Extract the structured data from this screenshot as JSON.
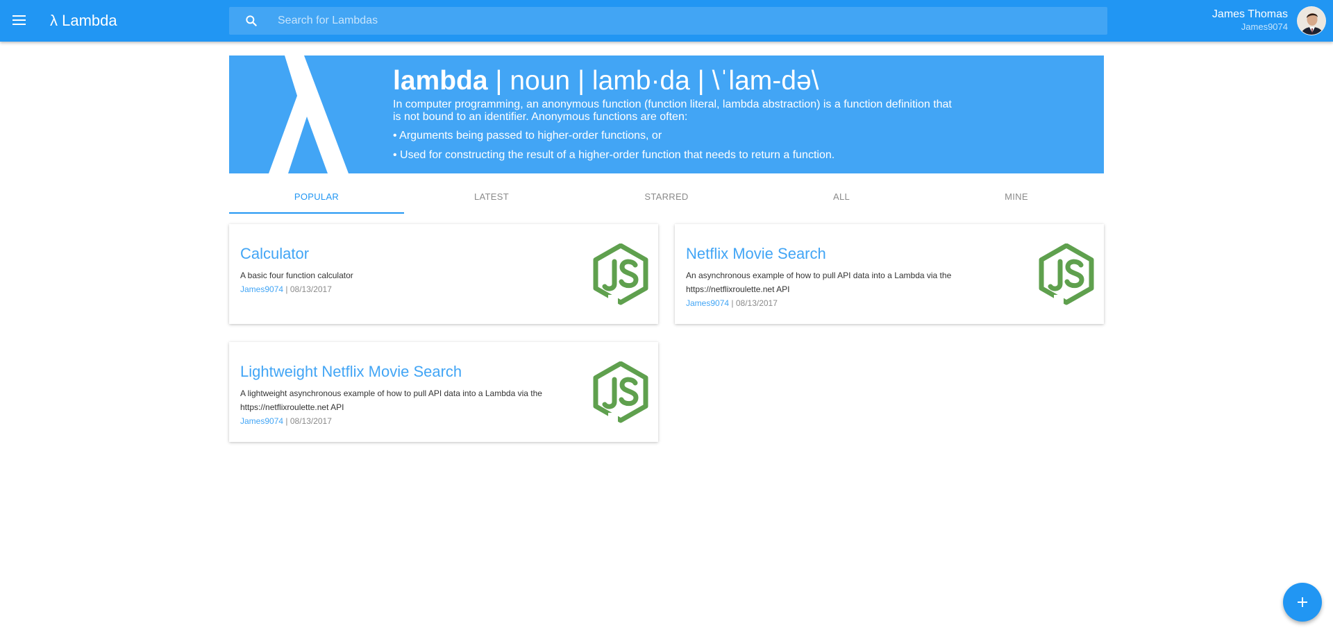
{
  "appbar": {
    "brand": "λ Lambda",
    "search_placeholder": "Search for Lambdas",
    "user_name": "James Thomas",
    "user_handle": "James9074"
  },
  "hero": {
    "word": "lambda",
    "definition_rest": " | noun | lamb·da | \\ˈlam-də\\",
    "description": "In computer programming, an anonymous function (function literal, lambda abstraction) is a function definition that is not bound to an identifier. Anonymous functions are often:",
    "bullets": [
      "• Arguments being passed to higher-order functions, or",
      "• Used for constructing the result of a higher-order function that needs to return a function."
    ]
  },
  "tabs": [
    {
      "label": "POPULAR",
      "active": true
    },
    {
      "label": "LATEST",
      "active": false
    },
    {
      "label": "STARRED",
      "active": false
    },
    {
      "label": "ALL",
      "active": false
    },
    {
      "label": "MINE",
      "active": false
    }
  ],
  "cards": [
    {
      "title": "Calculator",
      "description": "A basic four function calculator",
      "author": "James9074",
      "date": "08/13/2017",
      "icon": "nodejs-icon"
    },
    {
      "title": "Netflix Movie Search",
      "description": "An asynchronous example of how to pull API data into a Lambda via the https://netflixroulette.net API",
      "author": "James9074",
      "date": "08/13/2017",
      "icon": "nodejs-icon"
    },
    {
      "title": "Lightweight Netflix Movie Search",
      "description": "A lightweight asynchronous example of how to pull API data into a Lambda via the https://netflixroulette.net API",
      "author": "James9074",
      "date": "08/13/2017",
      "icon": "nodejs-icon"
    }
  ],
  "meta_separator": " | ",
  "colors": {
    "primary": "#2196f3",
    "hero": "#42a5f5",
    "node_green": "#5fa04e"
  }
}
